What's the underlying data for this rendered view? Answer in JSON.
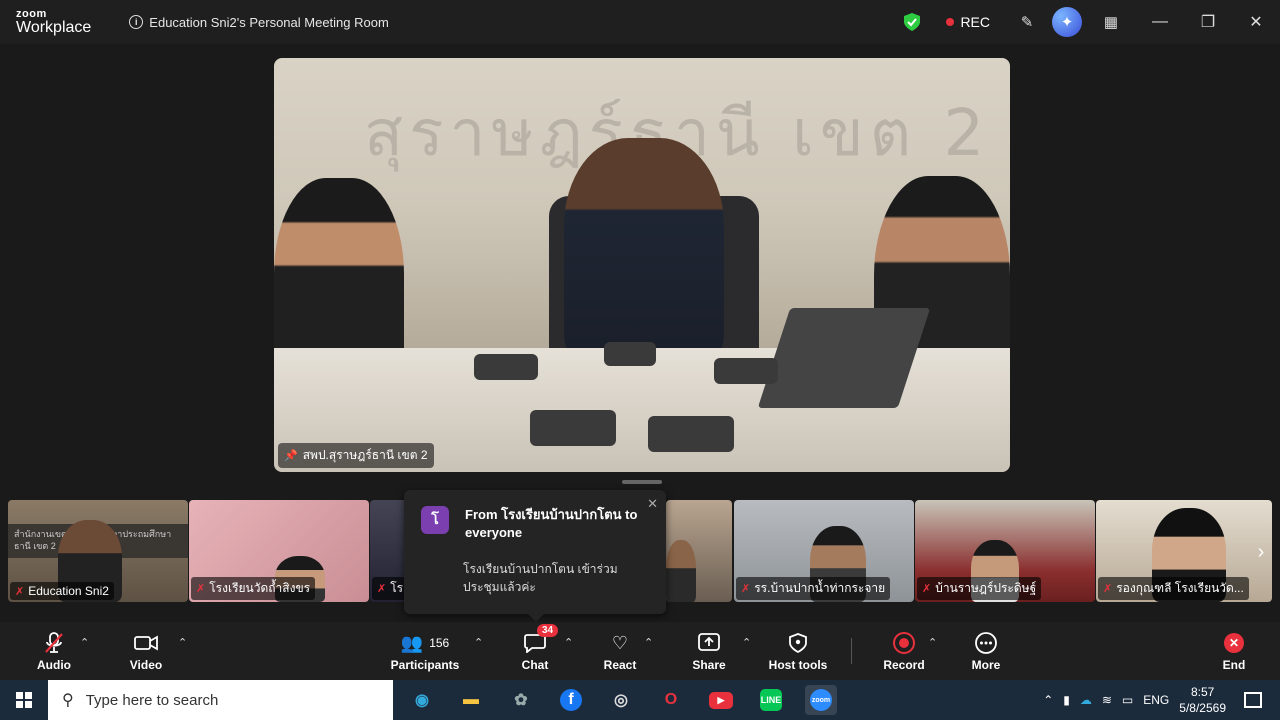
{
  "titlebar": {
    "brand_small": "zoom",
    "brand_large": "Workplace",
    "meeting_title": "Education Sni2's Personal Meeting Room",
    "rec_label": "REC"
  },
  "main_video": {
    "banner_text": "สุราษฎร์ธานี เขต 2",
    "name": "สพป.สุราษฎร์ธานี เขต 2"
  },
  "gallery": {
    "tiles": [
      {
        "name": "Education Sni2"
      },
      {
        "name": "โรงเรียนวัดถ้ำสิงขร"
      },
      {
        "name": "โร"
      },
      {
        "name": ""
      },
      {
        "name": "รร.บ้านปากน้ำท่ากระจาย"
      },
      {
        "name": "บ้านราษฎร์ประดิษฐ์"
      },
      {
        "name": "รองกุณฑลี โรงเรียนวัด..."
      }
    ],
    "tile1_sign": "สำนักงานเขตพื้นที่การศึกษาประถมศึกษา",
    "tile1_sign2": "ธานี เขต 2"
  },
  "chat_popup": {
    "avatar_letter": "โ",
    "from": "From โรงเรียนบ้านปากโตน to everyone",
    "message": "โรงเรียนบ้านปากโตน เข้าร่วมประชุมแล้วค่ะ"
  },
  "toolbar": {
    "audio": "Audio",
    "video": "Video",
    "participants": "Participants",
    "participants_count": "156",
    "chat": "Chat",
    "chat_badge": "34",
    "react": "React",
    "share": "Share",
    "host_tools": "Host tools",
    "record": "Record",
    "more": "More",
    "end": "End"
  },
  "taskbar": {
    "search_placeholder": "Type here to search",
    "lang": "ENG",
    "time": "8:57",
    "date": "5/8/2569"
  },
  "colors": {
    "accent_red": "#e8313c",
    "shield_green": "#2ecc40",
    "taskbar": "#1c2b3c"
  }
}
